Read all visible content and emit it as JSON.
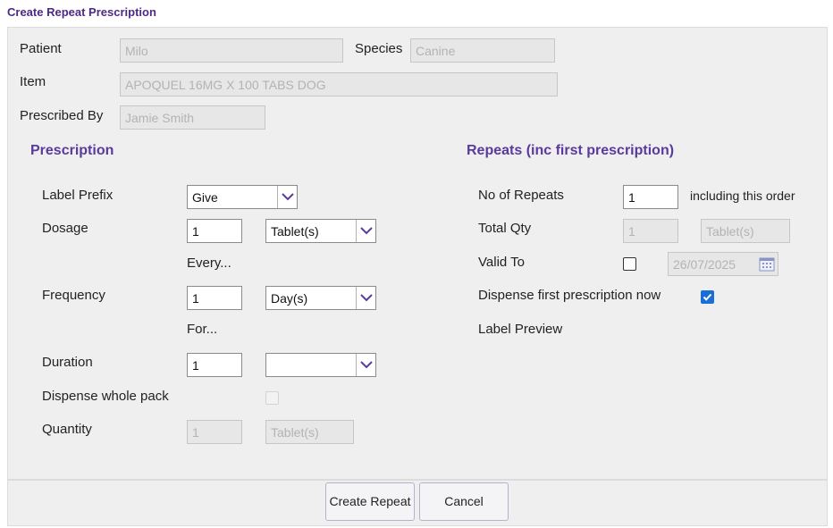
{
  "window": {
    "title": "Create Repeat Prescription"
  },
  "patient": {
    "patient_label": "Patient",
    "patient_value": "Milo",
    "species_label": "Species",
    "species_value": "Canine",
    "item_label": "Item",
    "item_value": "APOQUEL 16MG X 100 TABS DOG",
    "prescribed_by_label": "Prescribed By",
    "prescribed_by_value": "Jamie Smith"
  },
  "prescription": {
    "heading": "Prescription",
    "label_prefix_label": "Label Prefix",
    "label_prefix_value": "Give",
    "dosage_label": "Dosage",
    "dosage_value": "1",
    "dosage_unit": "Tablet(s)",
    "every_label": "Every...",
    "frequency_label": "Frequency",
    "frequency_value": "1",
    "frequency_unit": "Day(s)",
    "for_label": "For...",
    "duration_label": "Duration",
    "duration_value": "1",
    "duration_unit": "",
    "dispense_whole_pack_label": "Dispense whole pack",
    "dispense_whole_pack_checked": false,
    "quantity_label": "Quantity",
    "quantity_value": "1",
    "quantity_unit": "Tablet(s)"
  },
  "repeats": {
    "heading": "Repeats (inc first prescription)",
    "no_of_repeats_label": "No of Repeats",
    "no_of_repeats_value": "1",
    "including_label": "including this order",
    "total_qty_label": "Total Qty",
    "total_qty_value": "1",
    "total_qty_unit": "Tablet(s)",
    "valid_to_label": "Valid To",
    "valid_to_checked": false,
    "valid_to_value": "26/07/2025",
    "dispense_first_label": "Dispense first prescription now",
    "dispense_first_checked": true,
    "label_preview_label": "Label Preview"
  },
  "footer": {
    "create_repeat_label": "Create Repeat",
    "cancel_label": "Cancel"
  },
  "colors": {
    "accent": "#5a3a9c",
    "title": "#4b2a86",
    "check": "#1a6fd6"
  }
}
